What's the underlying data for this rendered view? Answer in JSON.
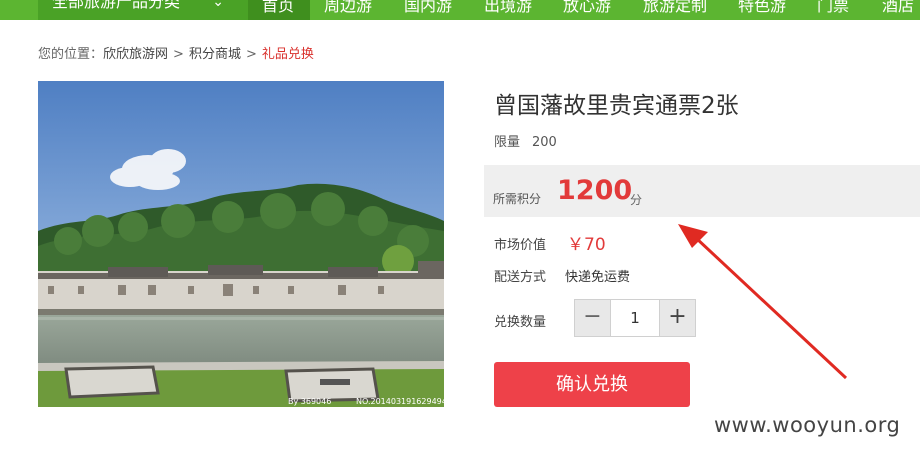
{
  "nav": {
    "category": "全部旅游产品分类",
    "items": [
      {
        "label": "首页",
        "active": true
      },
      {
        "label": "周边游"
      },
      {
        "label": "国内游"
      },
      {
        "label": "出境游"
      },
      {
        "label": "放心游"
      },
      {
        "label": "旅游定制"
      },
      {
        "label": "特色游"
      },
      {
        "label": "门票"
      },
      {
        "label": "酒店"
      }
    ]
  },
  "breadcrumb": {
    "prefix": "您的位置：",
    "items": [
      "欣欣旅游网",
      "积分商城"
    ],
    "current": "礼品兑换",
    "separator": ">"
  },
  "image": {
    "watermark_left": "By 369046",
    "watermark_right": "NO.201403191629494"
  },
  "product": {
    "title": "曾国藩故里贵宾通票2张",
    "limit_label": "限量",
    "limit_value": "200",
    "points_label": "所需积分",
    "points_value": "1200",
    "points_unit": "分",
    "market_label": "市场价值",
    "market_value": "￥70",
    "shipping_label": "配送方式",
    "shipping_value": "快递免运费",
    "quantity_label": "兑换数量",
    "quantity": "1",
    "minus": "−",
    "plus": "+",
    "confirm": "确认兑换"
  },
  "site_watermark": "www.wooyun.org",
  "colors": {
    "nav_green": "#5cb531",
    "accent_red": "#e23a3a",
    "button_red": "#ee4149"
  }
}
